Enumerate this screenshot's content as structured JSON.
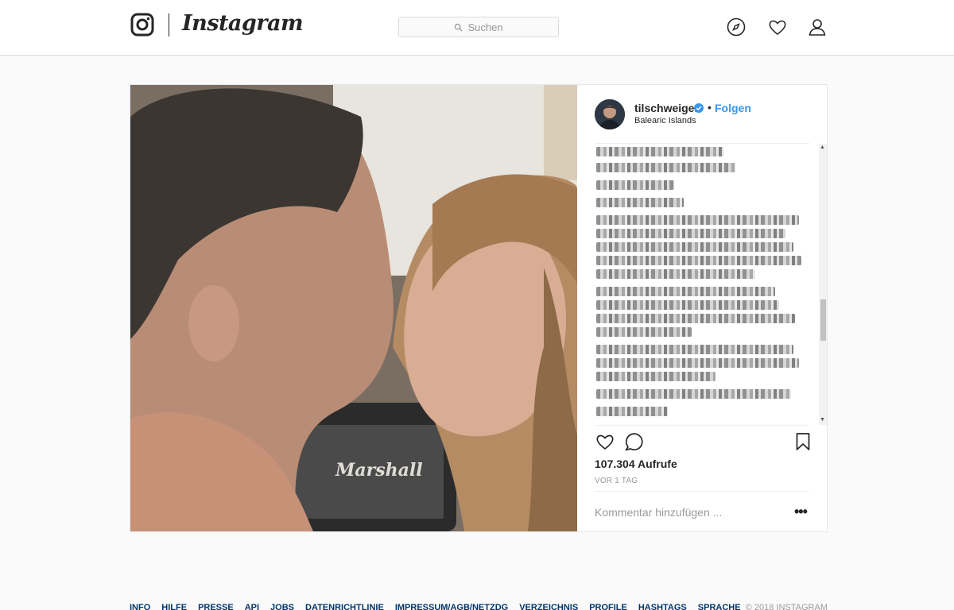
{
  "header": {
    "logo_text": "Instagram",
    "search_placeholder": "Suchen",
    "icons": [
      "instagram-glyph-icon",
      "compass-icon",
      "heart-icon",
      "user-icon"
    ]
  },
  "post": {
    "username": "tilschweiger",
    "follow_label": "Folgen",
    "separator": "•",
    "location": "Balearic Islands",
    "views": "107.304 Aufrufe",
    "timestamp": "VOR 1 TAG",
    "comment_placeholder": "Kommentar hinzufügen ...",
    "more_label": "•••",
    "media_text": "Marshall",
    "action_icons": [
      "heart-icon",
      "comment-icon",
      "bookmark-icon"
    ]
  },
  "footer": {
    "links": [
      "Info",
      "Hilfe",
      "Presse",
      "API",
      "Jobs",
      "Datenrichtlinie",
      "Impressum/AGB/NetzDG",
      "Verzeichnis",
      "Profile",
      "Hashtags",
      "Sprache"
    ],
    "copyright": "© 2018 Instagram"
  },
  "colors": {
    "accent": "#3897f0",
    "text": "#262626",
    "muted": "#999999",
    "background": "#fafafa",
    "footer_link": "#003569"
  }
}
